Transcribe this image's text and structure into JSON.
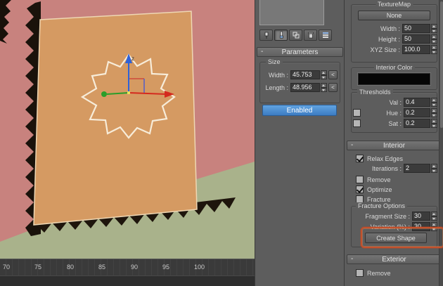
{
  "viewport": {
    "trackbar_ticks": [
      "70",
      "75",
      "80",
      "85",
      "90",
      "95",
      "100"
    ],
    "gizmo_z_label": "z"
  },
  "modifier_stack": {
    "toolbar_icons": [
      "pin-stack",
      "show-end-result",
      "make-unique",
      "remove-modifier",
      "configure-modifier-sets"
    ]
  },
  "parameters": {
    "collapse_glyph": "-",
    "title": "Parameters",
    "size_group_label": "Size",
    "width_label": "Width :",
    "width_value": "45.753",
    "width_sync_label": "<",
    "length_label": "Length :",
    "length_value": "48.956",
    "length_sync_label": "<",
    "enabled_button_label": "Enabled"
  },
  "texture_map": {
    "group_label": "TextureMap",
    "none_button_label": "None",
    "width_label": "Width :",
    "width_value": "50",
    "height_label": "Height :",
    "height_value": "50",
    "xyz_size_label": "XYZ Size :",
    "xyz_size_value": "100.0"
  },
  "interior_color": {
    "group_label": "Interior Color",
    "swatch_color": "#060606"
  },
  "thresholds": {
    "group_label": "Thresholds",
    "val_label": "Val :",
    "val_value": "0.4",
    "hue_label": "Hue :",
    "hue_value": "0.2",
    "hue_checked": false,
    "sat_label": "Sat :",
    "sat_value": "0.2",
    "sat_checked": false
  },
  "interior": {
    "collapse_glyph": "-",
    "title": "Interior",
    "relax_edges_label": "Relax Edges",
    "relax_edges_checked": true,
    "iterations_label": "Iterations :",
    "iterations_value": "2",
    "remove_label": "Remove",
    "remove_checked": false,
    "optimize_label": "Optimize",
    "optimize_checked": true,
    "fracture_label": "Fracture",
    "fracture_checked": false,
    "fracture_options": {
      "group_label": "Fracture Options",
      "fragment_size_label": "Fragment Size :",
      "fragment_size_value": "30",
      "variation_label": "Variation (%) :",
      "variation_value": "30",
      "create_shape_label": "Create Shape"
    }
  },
  "exterior": {
    "collapse_glyph": "-",
    "title": "Exterior",
    "remove_label": "Remove",
    "remove_checked": false
  },
  "colors": {
    "viewport_bg": "#c8827e",
    "ground": "#a9b28b",
    "plane": "#d59a62",
    "fractal_outline": "#f7ecd9",
    "enabled_button": "#4a8fd2",
    "annotation_highlight": "#c4512b"
  }
}
